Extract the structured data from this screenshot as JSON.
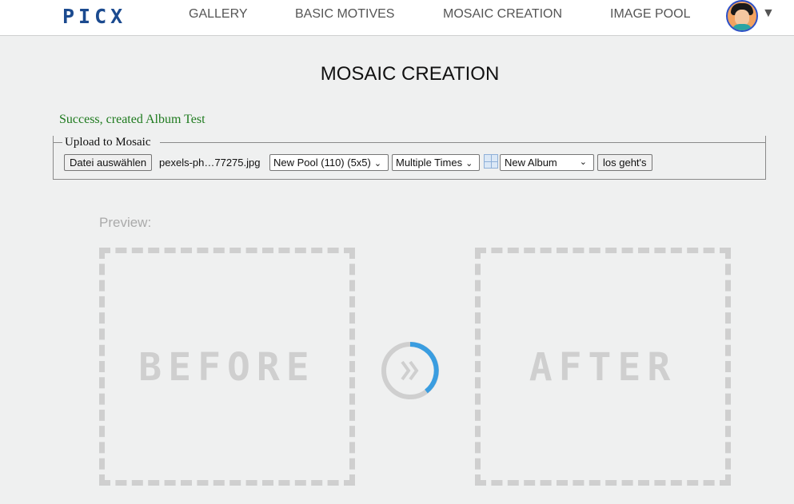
{
  "nav": {
    "logo": "PICX",
    "links": [
      "GALLERY",
      "BASIC MOTIVES",
      "MOSAIC CREATION",
      "IMAGE POOL"
    ],
    "caret": "▼"
  },
  "page": {
    "title": "MOSAIC CREATION",
    "success_message": "Success, created Album Test"
  },
  "upload": {
    "legend": "Upload to Mosaic",
    "file_button": "Datei auswählen",
    "file_name": "pexels-ph…77275.jpg",
    "pool_select": "New Pool (110) (5x5)",
    "times_select": "Multiple Times",
    "album_select": "New Album",
    "submit": "los geht's"
  },
  "preview": {
    "label": "Preview:",
    "before": "BEFORE",
    "after": "AFTER"
  },
  "colors": {
    "logo": "#1b4a8f",
    "success": "#1e7a1e",
    "spinner_accent": "#3a9de0",
    "placeholder": "#cfcfcf"
  }
}
